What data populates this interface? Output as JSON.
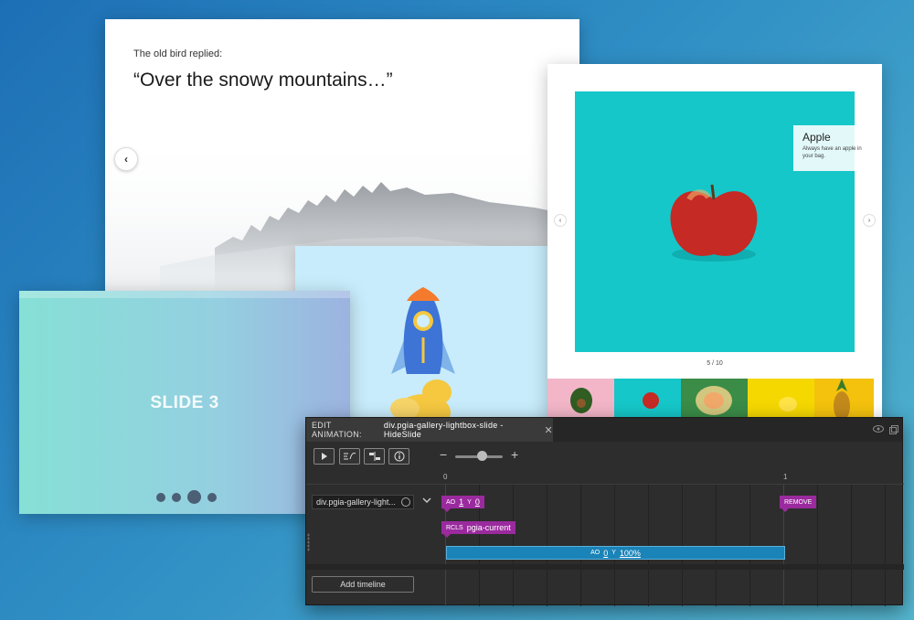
{
  "quote_card": {
    "eyebrow": "The old bird replied:",
    "quote": "“Over the snowy mountains…”",
    "prev_glyph": "‹"
  },
  "slide3_card": {
    "title": "SLIDE 3",
    "dots": 4,
    "active_dot": 2
  },
  "apple_card": {
    "caption_title": "Apple",
    "caption_text": "Always have an apple in your bag.",
    "counter": "5 / 10",
    "prev_glyph": "‹",
    "next_glyph": "›",
    "image_bg": "#16c7c9",
    "thumb_colors": [
      "#f2b6c8",
      "#16c7c9",
      "#3a8c47",
      "#f5d800",
      "#f4c20d"
    ]
  },
  "animation_panel": {
    "tab_prefix": "EDIT ANIMATION:",
    "tab_name": "div.pgia-gallery-lightbox-slide - HideSlide",
    "close_glyph": "✕",
    "ruler": [
      "0",
      "1"
    ],
    "element": "div.pgia-gallery-light...",
    "tags": {
      "ao": {
        "label_a": "AO",
        "value_a": "1",
        "label_b": "Y",
        "value_b": "0"
      },
      "remove": "REMOVE",
      "rcls": {
        "label": "RCLS",
        "value": "pgia-current"
      }
    },
    "bar": {
      "label_a": "AO",
      "value_a": "0",
      "label_b": "Y",
      "value_b": "100%"
    },
    "add_timeline": "Add timeline",
    "zoom_minus": "−",
    "zoom_plus": "+"
  }
}
